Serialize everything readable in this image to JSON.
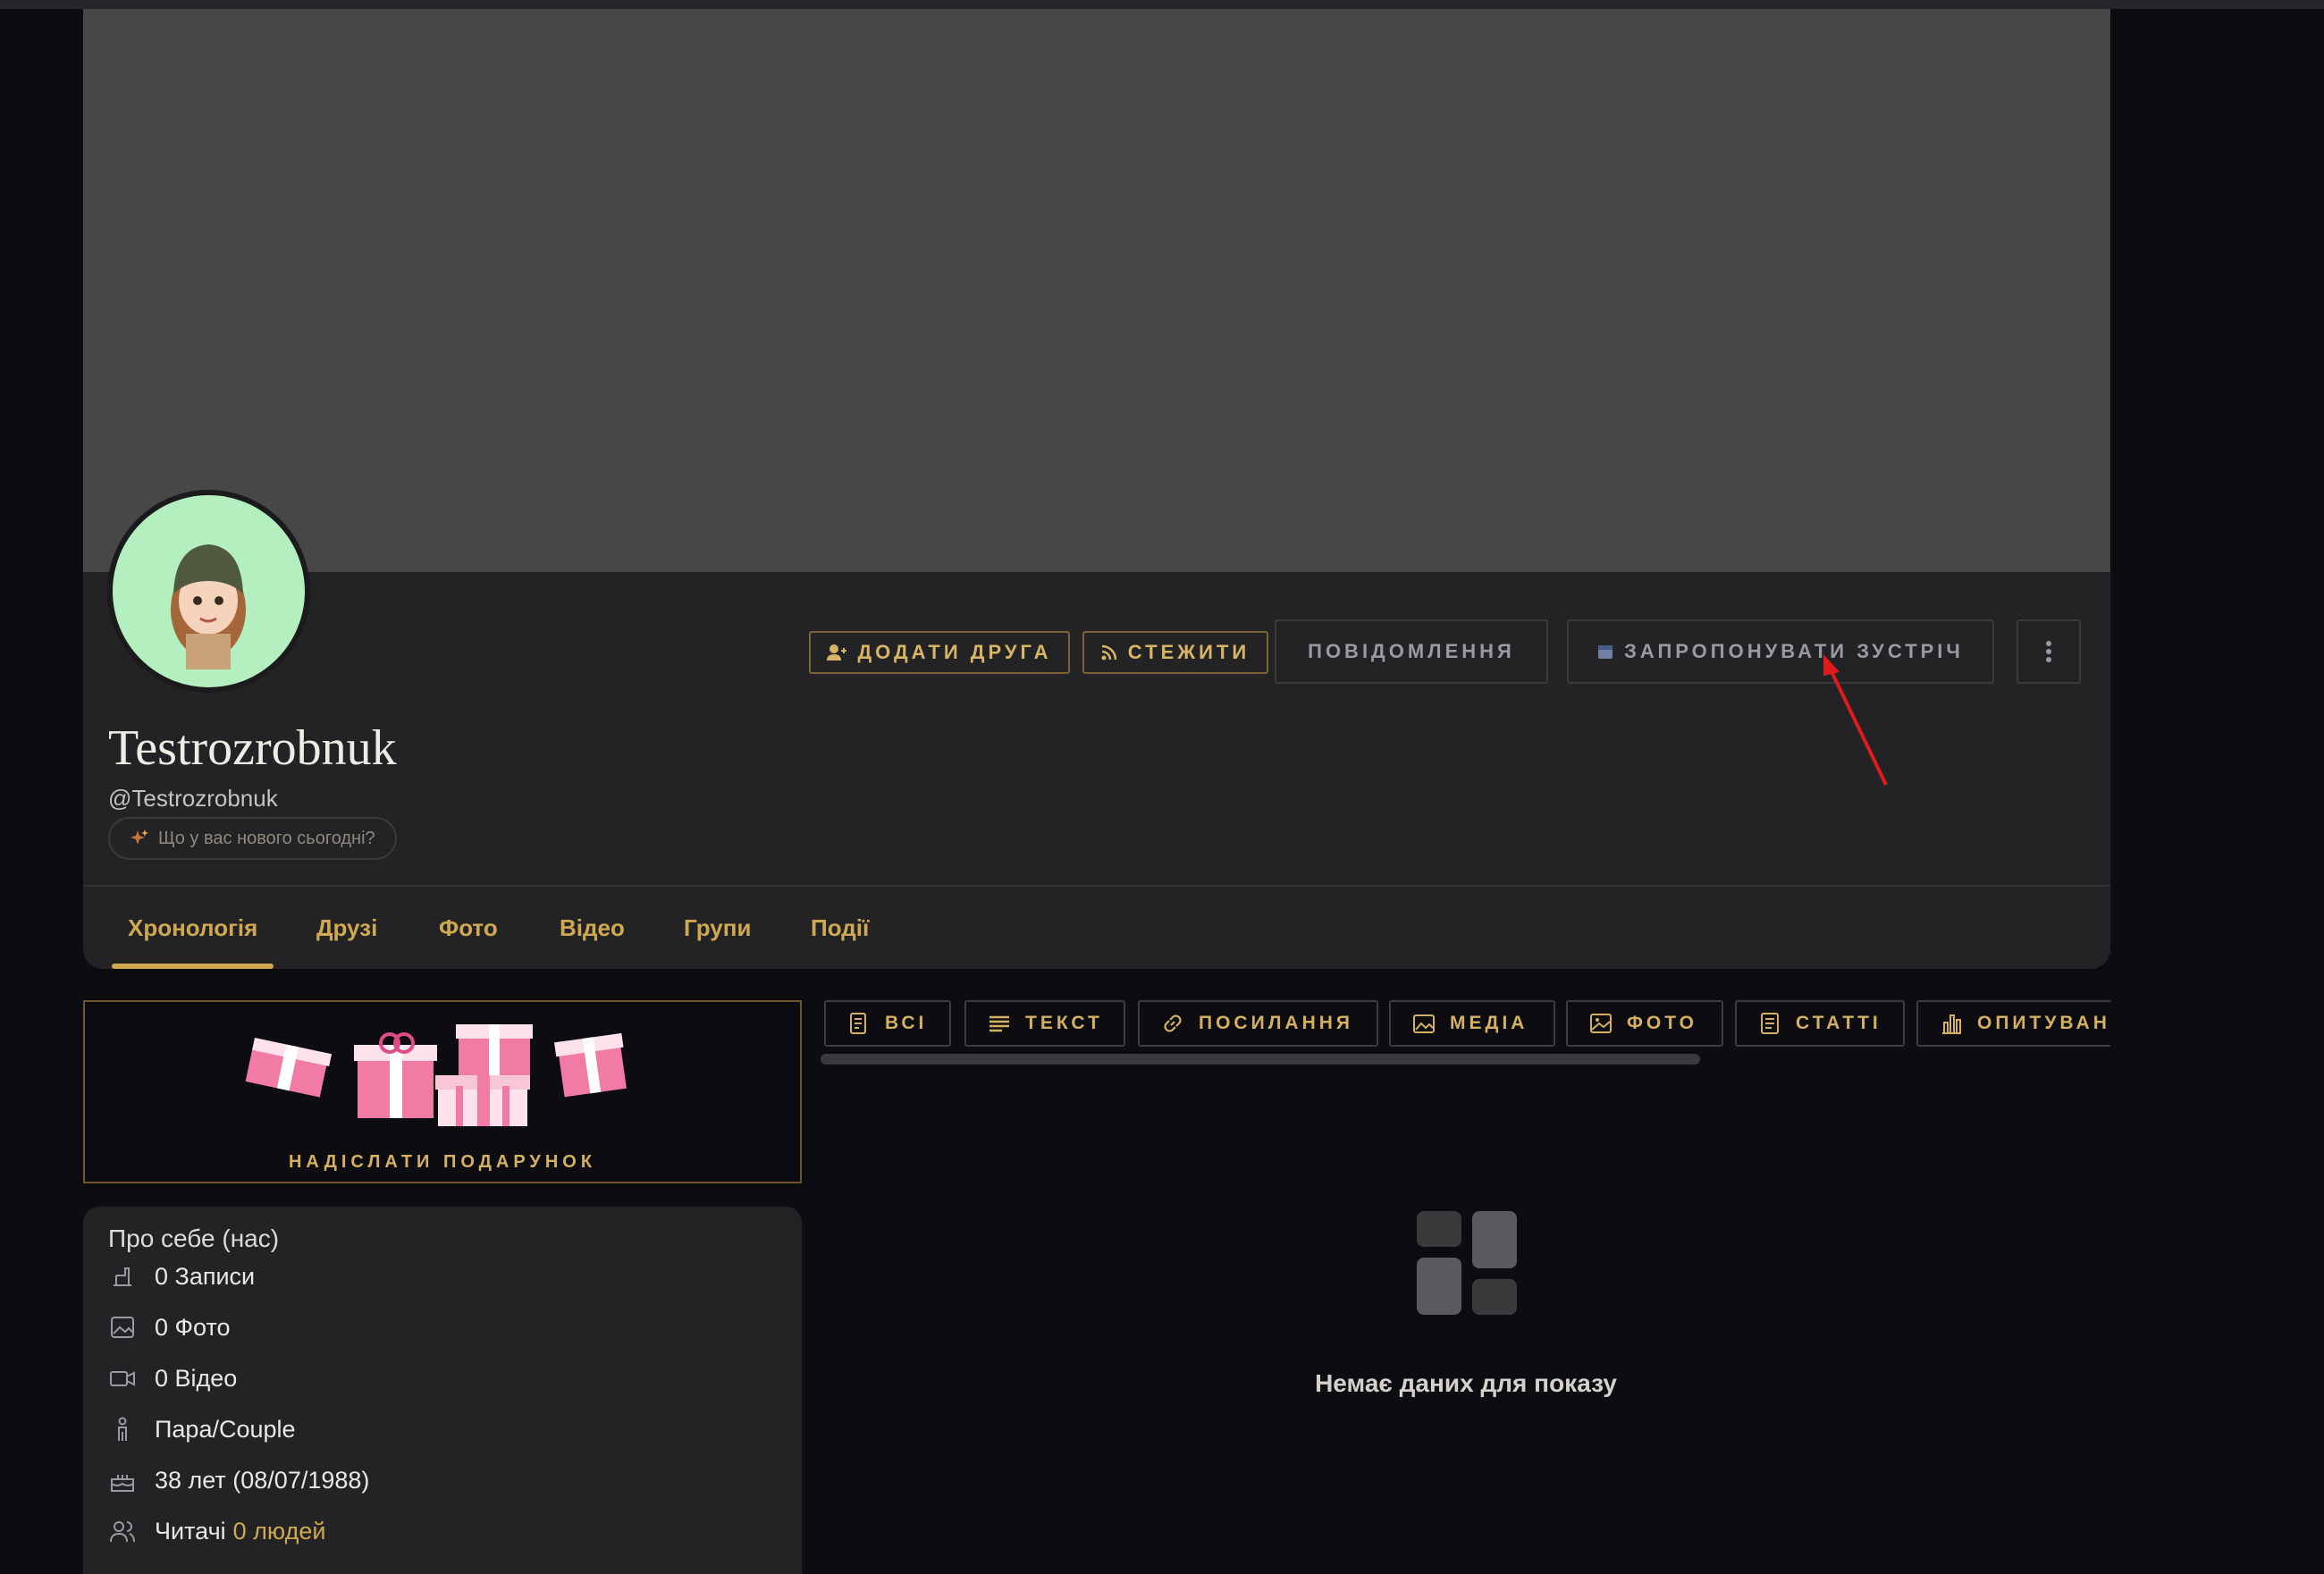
{
  "profile": {
    "name": "Testrozrobnuk",
    "handle": "@Testrozrobnuk",
    "status_prompt": "Що у вас нового сьогодні?"
  },
  "actions": {
    "add_friend": "ДОДАТИ ДРУГА",
    "follow": "СТЕЖИТИ",
    "message": "ПОВІДОМЛЕННЯ",
    "propose_meeting": "ЗАПРОПОНУВАТИ ЗУСТРІЧ"
  },
  "tabs": [
    "Хронологія",
    "Друзі",
    "Фото",
    "Відео",
    "Групи",
    "Події"
  ],
  "gift": {
    "label": "НАДІСЛАТИ ПОДАРУНОК"
  },
  "about": {
    "title": "Про себе (нас)",
    "posts": "0 Записи",
    "photos": "0 Фото",
    "videos": "0 Відео",
    "gender": "Пара/Couple",
    "age": "38 лет (08/07/1988)",
    "readers_label": "Читачі",
    "readers_value": "0 людей"
  },
  "filters": [
    "ВСІ",
    "ТЕКСТ",
    "ПОСИЛАННЯ",
    "МЕДІА",
    "ФОТО",
    "СТАТТІ",
    "ОПИТУВАН"
  ],
  "empty_state": "Немає даних для показу",
  "colors": {
    "accent": "#cfa952",
    "background": "#0d0c10",
    "card": "#232325",
    "annotation": "#e01b1b"
  }
}
